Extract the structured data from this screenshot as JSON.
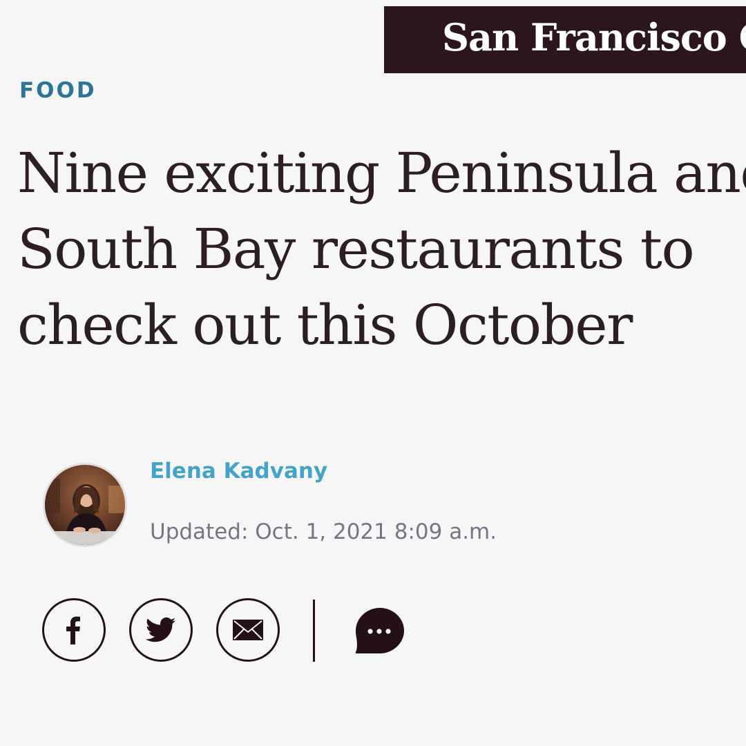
{
  "masthead": {
    "logo_text": "San Francisco Chronicle"
  },
  "article": {
    "section": "FOOD",
    "headline_lines": [
      "Nine exciting Peninsula and",
      "South Bay restaurants to",
      "check out this October"
    ],
    "author": "Elena Kadvany",
    "updated": "Updated: Oct. 1, 2021 8:09 a.m."
  },
  "share": {
    "icons": [
      "facebook-icon",
      "twitter-icon",
      "email-icon",
      "comment-icon"
    ]
  },
  "colors": {
    "section": "#2e7496",
    "author": "#45a3c7",
    "masthead_bg": "#2b161c",
    "icon_stroke": "#241118"
  }
}
